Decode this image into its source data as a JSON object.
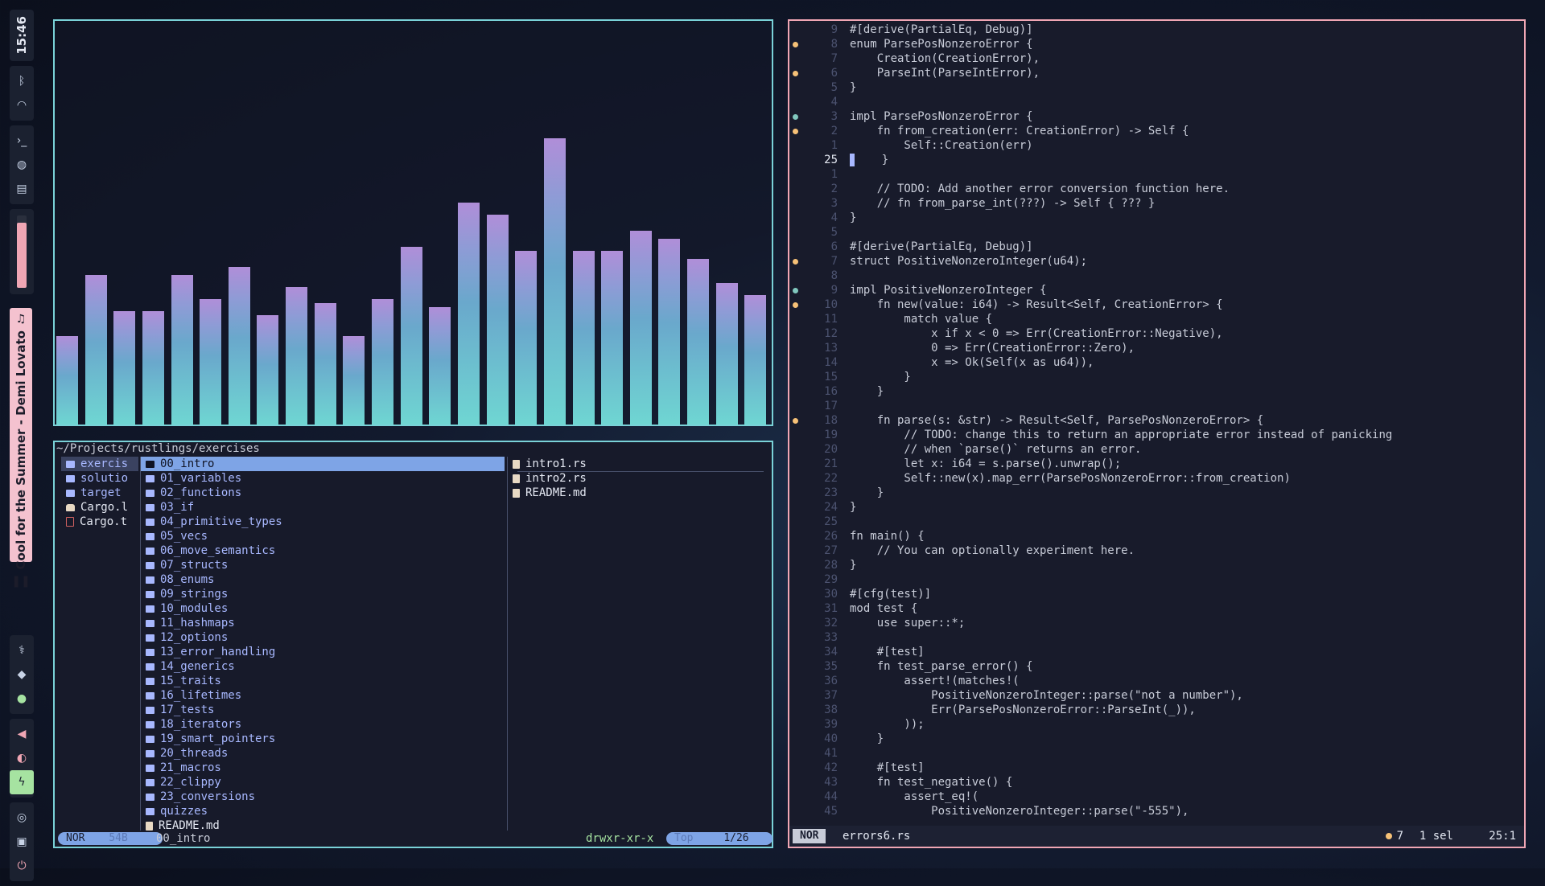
{
  "sidebar": {
    "clock": "15:46",
    "volume_level": 0.9,
    "top_icons": [
      "bluetooth-icon",
      "wifi-icon",
      "terminal-icon",
      "globe-icon",
      "clapperboard-icon"
    ],
    "bottom_icons": [
      "stethoscope-icon",
      "diamond-icon",
      "turtle-icon",
      "speaker-icon",
      "brightness-icon",
      "bolt-icon",
      "eye-off-icon",
      "lock-icon",
      "power-icon"
    ],
    "now_playing": "Cool for the Summer - Demi Lovato"
  },
  "visualizer": {
    "levels": [
      0.22,
      0.37,
      0.28,
      0.28,
      0.37,
      0.31,
      0.39,
      0.27,
      0.34,
      0.3,
      0.22,
      0.31,
      0.44,
      0.29,
      0.55,
      0.52,
      0.43,
      0.71,
      0.43,
      0.43,
      0.48,
      0.46,
      0.41,
      0.35,
      0.32
    ]
  },
  "filemgr": {
    "path": "~/Projects/rustlings/exercises",
    "parent": [
      {
        "name": "exercis",
        "type": "dir",
        "current": true
      },
      {
        "name": "solutio",
        "type": "dir"
      },
      {
        "name": "target",
        "type": "dir"
      },
      {
        "name": "Cargo.l",
        "type": "lock"
      },
      {
        "name": "Cargo.t",
        "type": "toml"
      }
    ],
    "current": [
      {
        "name": "00_intro",
        "type": "dir",
        "selected": true
      },
      {
        "name": "01_variables",
        "type": "dir"
      },
      {
        "name": "02_functions",
        "type": "dir"
      },
      {
        "name": "03_if",
        "type": "dir"
      },
      {
        "name": "04_primitive_types",
        "type": "dir"
      },
      {
        "name": "05_vecs",
        "type": "dir"
      },
      {
        "name": "06_move_semantics",
        "type": "dir"
      },
      {
        "name": "07_structs",
        "type": "dir"
      },
      {
        "name": "08_enums",
        "type": "dir"
      },
      {
        "name": "09_strings",
        "type": "dir"
      },
      {
        "name": "10_modules",
        "type": "dir"
      },
      {
        "name": "11_hashmaps",
        "type": "dir"
      },
      {
        "name": "12_options",
        "type": "dir"
      },
      {
        "name": "13_error_handling",
        "type": "dir"
      },
      {
        "name": "14_generics",
        "type": "dir"
      },
      {
        "name": "15_traits",
        "type": "dir"
      },
      {
        "name": "16_lifetimes",
        "type": "dir"
      },
      {
        "name": "17_tests",
        "type": "dir"
      },
      {
        "name": "18_iterators",
        "type": "dir"
      },
      {
        "name": "19_smart_pointers",
        "type": "dir"
      },
      {
        "name": "20_threads",
        "type": "dir"
      },
      {
        "name": "21_macros",
        "type": "dir"
      },
      {
        "name": "22_clippy",
        "type": "dir"
      },
      {
        "name": "23_conversions",
        "type": "dir"
      },
      {
        "name": "quizzes",
        "type": "dir"
      },
      {
        "name": "README.md",
        "type": "md"
      }
    ],
    "preview": [
      {
        "name": "intro1.rs",
        "type": "rs"
      },
      {
        "name": "intro2.rs",
        "type": "rs"
      },
      {
        "name": "README.md",
        "type": "md"
      }
    ],
    "status": {
      "mode": "NOR",
      "size": "54B",
      "name": "00_intro",
      "perms": "drwxr-xr-x",
      "scroll": "Top",
      "position": "1/26"
    }
  },
  "editor": {
    "lines": [
      {
        "n": "9",
        "t": "#[derive(PartialEq, Debug)]"
      },
      {
        "n": "8",
        "t": "enum ParsePosNonzeroError {",
        "g": "warn"
      },
      {
        "n": "7",
        "t": "    Creation(CreationError),"
      },
      {
        "n": "6",
        "t": "    ParseInt(ParseIntError),",
        "g": "warn"
      },
      {
        "n": "5",
        "t": "}"
      },
      {
        "n": "4",
        "t": ""
      },
      {
        "n": "3",
        "t": "impl ParsePosNonzeroError {",
        "g": "info"
      },
      {
        "n": "2",
        "t": "    fn from_creation(err: CreationError) -> Self {",
        "g": "warn"
      },
      {
        "n": "1",
        "t": "        Self::Creation(err)"
      },
      {
        "n": "25",
        "t": "    }",
        "cur": true
      },
      {
        "n": "1",
        "t": ""
      },
      {
        "n": "2",
        "t": "    // TODO: Add another error conversion function here."
      },
      {
        "n": "3",
        "t": "    // fn from_parse_int(???) -> Self { ??? }"
      },
      {
        "n": "4",
        "t": "}"
      },
      {
        "n": "5",
        "t": ""
      },
      {
        "n": "6",
        "t": "#[derive(PartialEq, Debug)]"
      },
      {
        "n": "7",
        "t": "struct PositiveNonzeroInteger(u64);",
        "g": "warn"
      },
      {
        "n": "8",
        "t": ""
      },
      {
        "n": "9",
        "t": "impl PositiveNonzeroInteger {",
        "g": "info"
      },
      {
        "n": "10",
        "t": "    fn new(value: i64) -> Result<Self, CreationError> {",
        "g": "warn"
      },
      {
        "n": "11",
        "t": "        match value {"
      },
      {
        "n": "12",
        "t": "            x if x < 0 => Err(CreationError::Negative),"
      },
      {
        "n": "13",
        "t": "            0 => Err(CreationError::Zero),"
      },
      {
        "n": "14",
        "t": "            x => Ok(Self(x as u64)),"
      },
      {
        "n": "15",
        "t": "        }"
      },
      {
        "n": "16",
        "t": "    }"
      },
      {
        "n": "17",
        "t": ""
      },
      {
        "n": "18",
        "t": "    fn parse(s: &str) -> Result<Self, ParsePosNonzeroError> {",
        "g": "warn"
      },
      {
        "n": "19",
        "t": "        // TODO: change this to return an appropriate error instead of panicking"
      },
      {
        "n": "20",
        "t": "        // when `parse()` returns an error."
      },
      {
        "n": "21",
        "t": "        let x: i64 = s.parse().unwrap();"
      },
      {
        "n": "22",
        "t": "        Self::new(x).map_err(ParsePosNonzeroError::from_creation)"
      },
      {
        "n": "23",
        "t": "    }"
      },
      {
        "n": "24",
        "t": "}"
      },
      {
        "n": "25",
        "t": ""
      },
      {
        "n": "26",
        "t": "fn main() {"
      },
      {
        "n": "27",
        "t": "    // You can optionally experiment here."
      },
      {
        "n": "28",
        "t": "}"
      },
      {
        "n": "29",
        "t": ""
      },
      {
        "n": "30",
        "t": "#[cfg(test)]"
      },
      {
        "n": "31",
        "t": "mod test {"
      },
      {
        "n": "32",
        "t": "    use super::*;"
      },
      {
        "n": "33",
        "t": ""
      },
      {
        "n": "34",
        "t": "    #[test]"
      },
      {
        "n": "35",
        "t": "    fn test_parse_error() {"
      },
      {
        "n": "36",
        "t": "        assert!(matches!("
      },
      {
        "n": "37",
        "t": "            PositiveNonzeroInteger::parse(\"not a number\"),"
      },
      {
        "n": "38",
        "t": "            Err(ParsePosNonzeroError::ParseInt(_)),"
      },
      {
        "n": "39",
        "t": "        ));"
      },
      {
        "n": "40",
        "t": "    }"
      },
      {
        "n": "41",
        "t": ""
      },
      {
        "n": "42",
        "t": "    #[test]"
      },
      {
        "n": "43",
        "t": "    fn test_negative() {"
      },
      {
        "n": "44",
        "t": "        assert_eq!("
      },
      {
        "n": "45",
        "t": "            PositiveNonzeroInteger::parse(\"-555\"),"
      }
    ],
    "status": {
      "mode": "NOR",
      "file": "errors6.rs",
      "diagnostics": "7",
      "selection": "1 sel",
      "position": "25:1"
    }
  },
  "colors": {
    "accent_cyan": "#7ad2d8",
    "accent_pink": "#f0a6b4",
    "selection_blue": "#7ea4e6",
    "warning": "#f6c177",
    "info": "#81c8be"
  }
}
